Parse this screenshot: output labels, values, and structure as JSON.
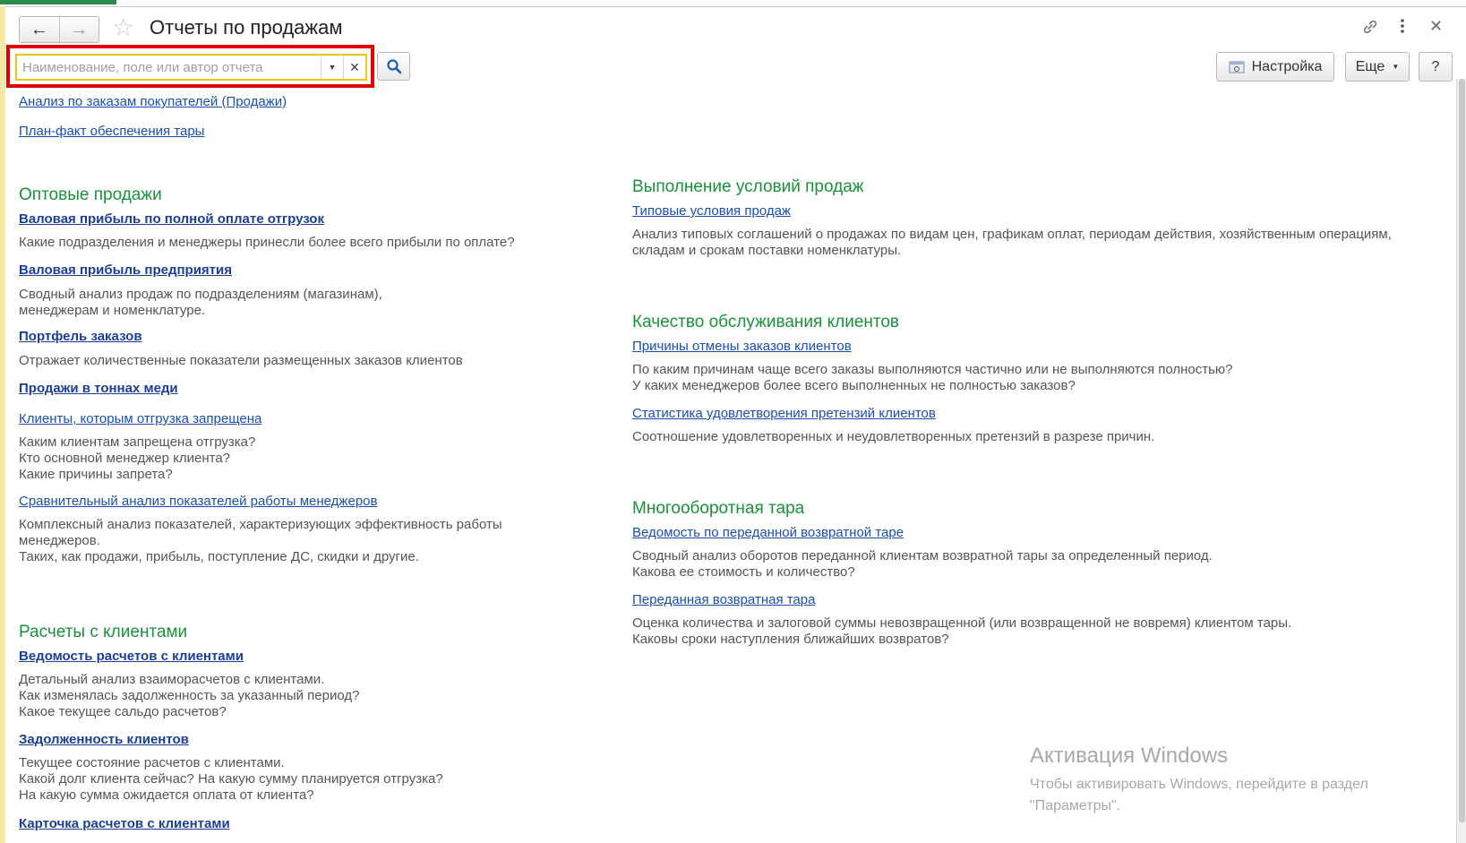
{
  "header": {
    "title": "Отчеты по продажам",
    "settings_label": "Настройка",
    "more_label": "Еще",
    "help_label": "?"
  },
  "search": {
    "placeholder": "Наименование, поле или автор отчета",
    "value": ""
  },
  "top_links": [
    "Анализ по заказам покупателей (Продажи)",
    "План-факт обеспечения тары"
  ],
  "left": {
    "wholesale": {
      "title": "Оптовые продажи",
      "items": [
        {
          "label": "Валовая прибыль по полной оплате отгрузок",
          "desc": [
            "Какие подразделения и менеджеры принесли более всего прибыли по оплате?"
          ]
        },
        {
          "label": "Валовая прибыль предприятия",
          "desc": [
            "Сводный анализ продаж по подразделениям (магазинам),",
            "менеджерам и номенклатуре."
          ]
        },
        {
          "label": "Портфель заказов",
          "desc": [
            "Отражает количественные показатели размещенных заказов клиентов"
          ]
        },
        {
          "label": "Продажи в тоннах меди",
          "desc": []
        },
        {
          "label": "Клиенты, которым отгрузка запрещена",
          "desc": [
            "Каким клиентам запрещена отгрузка?",
            "Кто основной менеджер клиента?",
            "Какие причины запрета?"
          ]
        },
        {
          "label": "Сравнительный анализ показателей работы менеджеров",
          "desc": [
            "Комплексный анализ показателей, характеризующих эффективность работы",
            "менеджеров.",
            "Таких, как продажи, прибыль, поступление ДС, скидки и другие."
          ]
        }
      ]
    },
    "settlements": {
      "title": "Расчеты с клиентами",
      "items": [
        {
          "label": "Ведомость расчетов с клиентами",
          "desc": [
            "Детальный анализ взаиморасчетов с клиентами.",
            "Как изменялась задолженность за указанный период?",
            "Какое текущее сальдо расчетов?"
          ]
        },
        {
          "label": "Задолженность клиентов",
          "desc": [
            "Текущее состояние расчетов с клиентами.",
            "Какой долг клиента сейчас? На какую сумму планируется отгрузка?",
            "На какую сумма ожидается оплата от клиента?"
          ]
        },
        {
          "label": "Карточка расчетов с клиентами",
          "desc": []
        }
      ]
    }
  },
  "right": {
    "conditions": {
      "title": "Выполнение условий продаж",
      "items": [
        {
          "label": "Типовые условия продаж",
          "desc": [
            "Анализ типовых соглашений о продажах по видам цен, графикам оплат, периодам действия, хозяйственным операциям,",
            "складам и срокам поставки номенклатуры."
          ]
        }
      ]
    },
    "quality": {
      "title": "Качество обслуживания клиентов",
      "items": [
        {
          "label": "Причины отмены заказов клиентов",
          "desc": [
            "По каким причинам чаще всего заказы выполняются частично или не выполняются полностью?",
            "У каких менеджеров более всего выполненных не полностью заказов?"
          ]
        },
        {
          "label": "Статистика удовлетворения претензий клиентов",
          "desc": [
            "Соотношение удовлетворенных и неудовлетворенных претензий в разрезе причин."
          ]
        }
      ]
    },
    "tare": {
      "title": "Многооборотная тара",
      "items": [
        {
          "label": "Ведомость по переданной возвратной таре",
          "desc": [
            "Сводный анализ оборотов переданной клиентам возвратной тары за определенный период.",
            "Какова ее стоимость и количество?"
          ]
        },
        {
          "label": "Переданная возвратная тара",
          "desc": [
            "Оценка количества и залоговой суммы невозвращенной (или возвращенной не вовремя) клиентом тары.",
            "Каковы сроки наступления ближайших возвратов?"
          ]
        }
      ]
    }
  },
  "watermark": {
    "title": "Активация Windows",
    "line1": "Чтобы активировать Windows, перейдите в раздел",
    "line2": "\"Параметры\"."
  },
  "colors": {
    "section_green": "#19923b",
    "link_blue": "#1a4eb3",
    "highlight_red": "#e30000",
    "search_border": "#f0c51a"
  }
}
